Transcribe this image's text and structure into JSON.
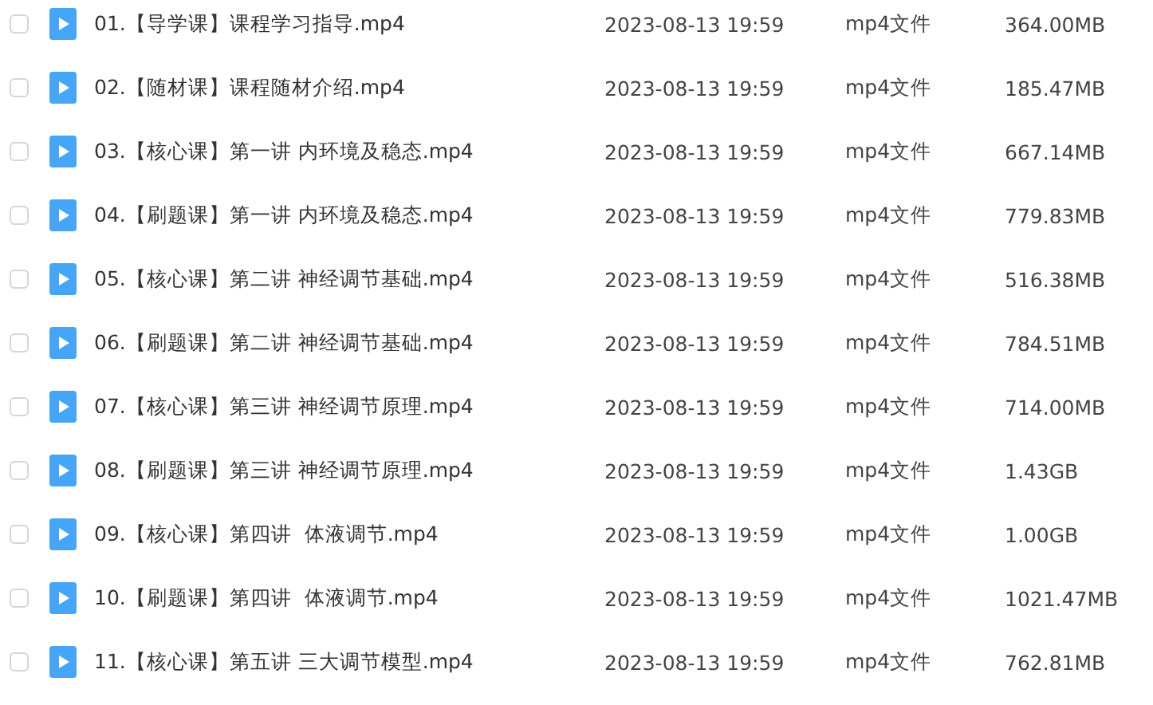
{
  "files": [
    {
      "name": "01.【导学课】课程学习指导.mp4",
      "modified": "2023-08-13 19:59",
      "type": "mp4文件",
      "size": "364.00MB",
      "checked": false
    },
    {
      "name": "02.【随材课】课程随材介绍.mp4",
      "modified": "2023-08-13 19:59",
      "type": "mp4文件",
      "size": "185.47MB",
      "checked": false
    },
    {
      "name": "03.【核心课】第一讲 内环境及稳态.mp4",
      "modified": "2023-08-13 19:59",
      "type": "mp4文件",
      "size": "667.14MB",
      "checked": false
    },
    {
      "name": "04.【刷题课】第一讲 内环境及稳态.mp4",
      "modified": "2023-08-13 19:59",
      "type": "mp4文件",
      "size": "779.83MB",
      "checked": false
    },
    {
      "name": "05.【核心课】第二讲 神经调节基础.mp4",
      "modified": "2023-08-13 19:59",
      "type": "mp4文件",
      "size": "516.38MB",
      "checked": false
    },
    {
      "name": "06.【刷题课】第二讲 神经调节基础.mp4",
      "modified": "2023-08-13 19:59",
      "type": "mp4文件",
      "size": "784.51MB",
      "checked": false
    },
    {
      "name": "07.【核心课】第三讲 神经调节原理.mp4",
      "modified": "2023-08-13 19:59",
      "type": "mp4文件",
      "size": "714.00MB",
      "checked": false
    },
    {
      "name": "08.【刷题课】第三讲 神经调节原理.mp4",
      "modified": "2023-08-13 19:59",
      "type": "mp4文件",
      "size": "1.43GB",
      "checked": false
    },
    {
      "name": "09.【核心课】第四讲  体液调节.mp4",
      "modified": "2023-08-13 19:59",
      "type": "mp4文件",
      "size": "1.00GB",
      "checked": false
    },
    {
      "name": "10.【刷题课】第四讲  体液调节.mp4",
      "modified": "2023-08-13 19:59",
      "type": "mp4文件",
      "size": "1021.47MB",
      "checked": false
    },
    {
      "name": "11.【核心课】第五讲 三大调节模型.mp4",
      "modified": "2023-08-13 19:59",
      "type": "mp4文件",
      "size": "762.81MB",
      "checked": false
    }
  ]
}
